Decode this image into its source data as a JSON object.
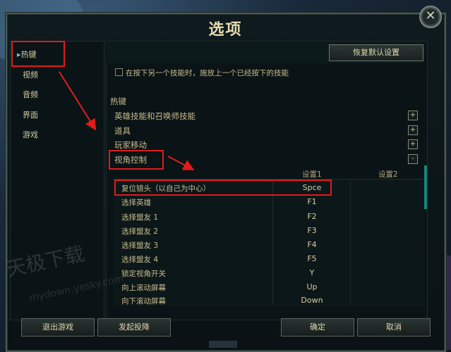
{
  "dialog": {
    "title": "选项",
    "close_symbol": "✕"
  },
  "sidebar": {
    "items": [
      {
        "label": "热键",
        "marker": "▸"
      },
      {
        "label": "视频"
      },
      {
        "label": "音频"
      },
      {
        "label": "界面"
      },
      {
        "label": "游戏"
      }
    ]
  },
  "main": {
    "reset_label": "恢复默认设置",
    "checkbox_label": "在按下另一个技能时，施放上一个已经按下的技能",
    "section_title": "热键",
    "categories": [
      {
        "label": "英雄技能和召唤师技能",
        "toggle": "+"
      },
      {
        "label": "道具",
        "toggle": "+"
      },
      {
        "label": "玩家移动",
        "toggle": "+"
      },
      {
        "label": "视角控制",
        "toggle": "-"
      }
    ],
    "columns": {
      "col1": "设置1",
      "col2": "设置2"
    },
    "rows": [
      {
        "label": "复位镜头（以自己为中心）",
        "value": "Spce"
      },
      {
        "label": "选择英雄",
        "value": "F1"
      },
      {
        "label": "选择盟友 1",
        "value": "F2"
      },
      {
        "label": "选择盟友 2",
        "value": "F3"
      },
      {
        "label": "选择盟友 3",
        "value": "F4"
      },
      {
        "label": "选择盟友 4",
        "value": "F5"
      },
      {
        "label": "锁定视角开关",
        "value": "Y"
      },
      {
        "label": "向上滚动屏幕",
        "value": "Up"
      },
      {
        "label": "向下滚动屏幕",
        "value": "Down"
      }
    ]
  },
  "footer": {
    "quit": "退出游戏",
    "surrender": "发起投降",
    "ok": "确定",
    "cancel": "取消"
  },
  "watermark": {
    "line1": "天极下载",
    "line2": "mydown.yesky.com"
  },
  "colors": {
    "annotation_red": "#e01c1c",
    "scrollbar": "#16857a",
    "text_gold": "#c8bc8e"
  }
}
